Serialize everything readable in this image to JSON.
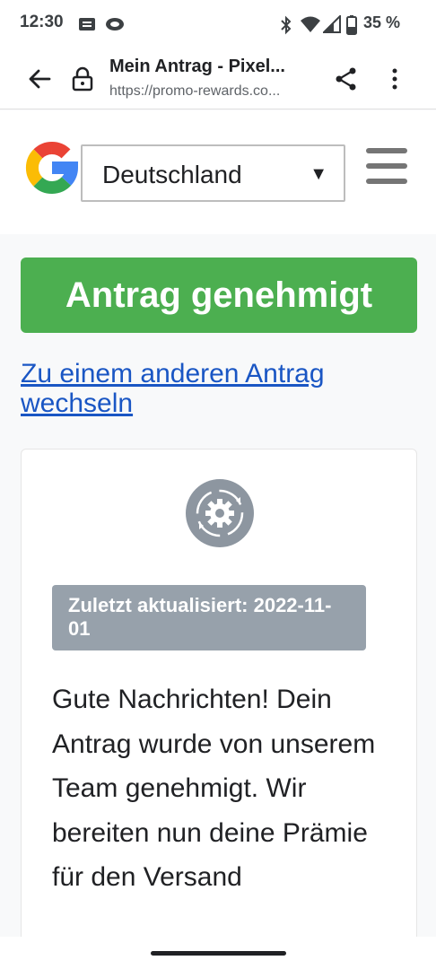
{
  "status_bar": {
    "time": "12:30",
    "battery": "35 %"
  },
  "browser": {
    "title": "Mein Antrag - Pixel...",
    "url": "https://promo-rewards.co..."
  },
  "header": {
    "country": "Deutschland",
    "dropdown_arrow": "▼"
  },
  "main": {
    "status_label": "Antrag genehmigt",
    "status_color": "#4caf50",
    "switch_link": "Zu einem anderen Antrag wechseln",
    "updated": "Zuletzt aktualisiert: 2022-11-01",
    "message": "Gute Nachrichten! Dein Antrag wurde von unserem Team genehmigt. Wir bereiten nun deine Prämie für den Versand"
  },
  "icons": {
    "status": [
      "sim-card-icon",
      "cloud-icon",
      "bluetooth-icon",
      "wifi-icon",
      "signal-icon",
      "battery-icon"
    ],
    "toolbar": [
      "back-arrow-icon",
      "lock-icon",
      "share-icon",
      "more-vert-icon"
    ],
    "card": "gear-sync-icon"
  }
}
